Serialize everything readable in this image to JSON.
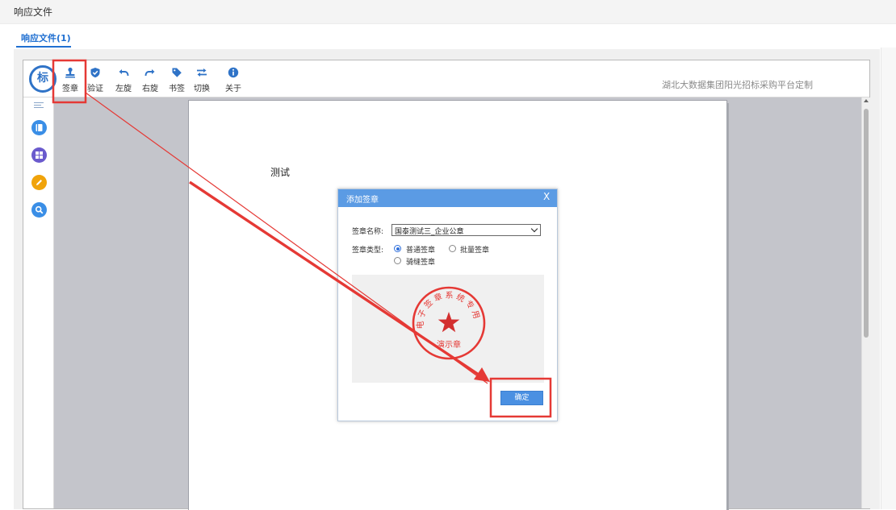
{
  "page": {
    "title": "响应文件"
  },
  "tabs": [
    {
      "label": "响应文件(1)",
      "active": true
    }
  ],
  "toolbar": {
    "logo": "标",
    "items": [
      {
        "name": "stamp",
        "label": "签章",
        "icon": "stamp-icon"
      },
      {
        "name": "verify",
        "label": "验证",
        "icon": "shield-check-icon"
      },
      {
        "name": "rotate-left",
        "label": "左旋",
        "icon": "rotate-left-icon"
      },
      {
        "name": "rotate-right",
        "label": "右旋",
        "icon": "rotate-right-icon"
      },
      {
        "name": "bookmark",
        "label": "书签",
        "icon": "tag-icon"
      },
      {
        "name": "switch",
        "label": "切换",
        "icon": "swap-icon"
      },
      {
        "name": "about",
        "label": "关于",
        "icon": "info-icon"
      }
    ],
    "brand": "湖北大数据集团阳光招标采购平台定制"
  },
  "sidebar": [
    {
      "name": "menu",
      "icon": "menu-lines-icon"
    },
    {
      "name": "thumbnails",
      "icon": "book-icon",
      "color": "#3a8ee6"
    },
    {
      "name": "grid",
      "icon": "grid-icon",
      "color": "#6a5acd"
    },
    {
      "name": "annotate",
      "icon": "pencil-icon",
      "color": "#f0a30a"
    },
    {
      "name": "search",
      "icon": "search-icon",
      "color": "#3a8ee6"
    }
  ],
  "document": {
    "text": "测试"
  },
  "dialog": {
    "title": "添加签章",
    "close": "X",
    "seal_name_label": "签章名称:",
    "seal_name_value": "国泰测试三_企业公章",
    "seal_type_label": "签章类型:",
    "seal_types": [
      {
        "label": "普通签章",
        "checked": true
      },
      {
        "label": "批量签章",
        "checked": false
      },
      {
        "label": "骑缝签章",
        "checked": false
      }
    ],
    "seal_ring_text": "电子签章系统专用",
    "seal_bottom_text": "演示章",
    "confirm": "确定"
  },
  "colors": {
    "accent": "#1f6fd1",
    "dialog_header": "#5b9be4",
    "annotation": "#e53935",
    "seal": "#e53935"
  }
}
